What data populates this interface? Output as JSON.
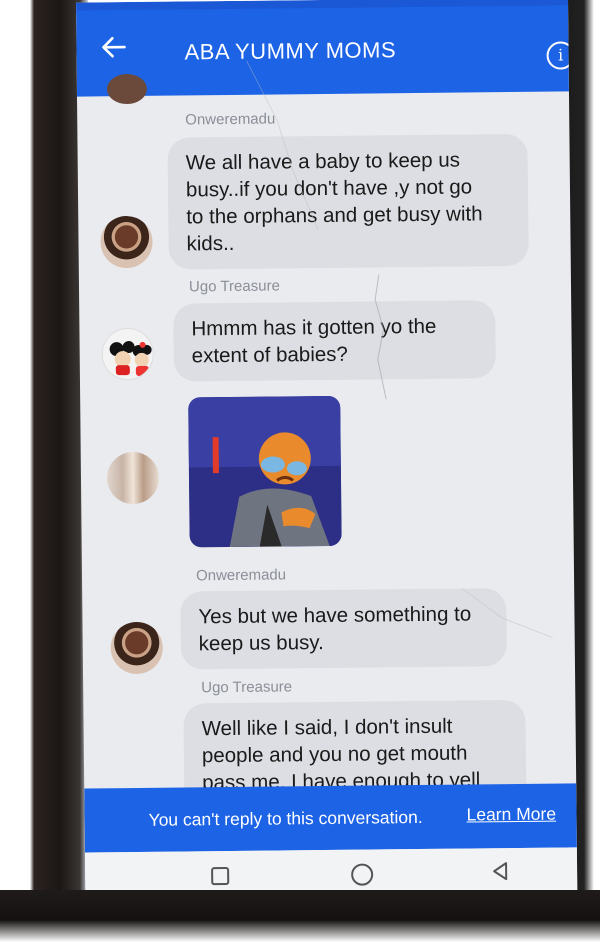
{
  "header": {
    "title": "ABA YUMMY MOMS",
    "back_icon": "back-arrow-icon",
    "info_icon": "info-icon",
    "info_glyph": "i"
  },
  "messages": [
    {
      "sender": "Onweremadu",
      "lines": [
        "We all have a baby to keep us",
        "busy..if you don't have ,y not go",
        "to the orphans and get busy with",
        "kids.."
      ]
    },
    {
      "sender": "Ugo Treasure",
      "lines": [
        "Hmmm has it gotten yo the",
        "extent of babies?"
      ]
    },
    {
      "sender": "",
      "sticker": "crying-cartoon-sticker"
    },
    {
      "sender": "Onweremadu",
      "lines": [
        "Yes but we have something to",
        "keep us busy."
      ]
    },
    {
      "sender": "Ugo Treasure",
      "lines": [
        "Well like I said, I don't insult",
        "people and you no get mouth",
        "pass me. I have enough to yell"
      ]
    }
  ],
  "footer": {
    "notice": "You can't reply to this conversation.",
    "link": "Learn More"
  },
  "nav": {
    "recents_icon": "square-icon",
    "home_icon": "circle-icon",
    "back_icon": "triangle-back-icon"
  },
  "colors": {
    "brand": "#1d63e6",
    "bubble": "#dcdee3",
    "sender_text": "#8b8f97"
  }
}
